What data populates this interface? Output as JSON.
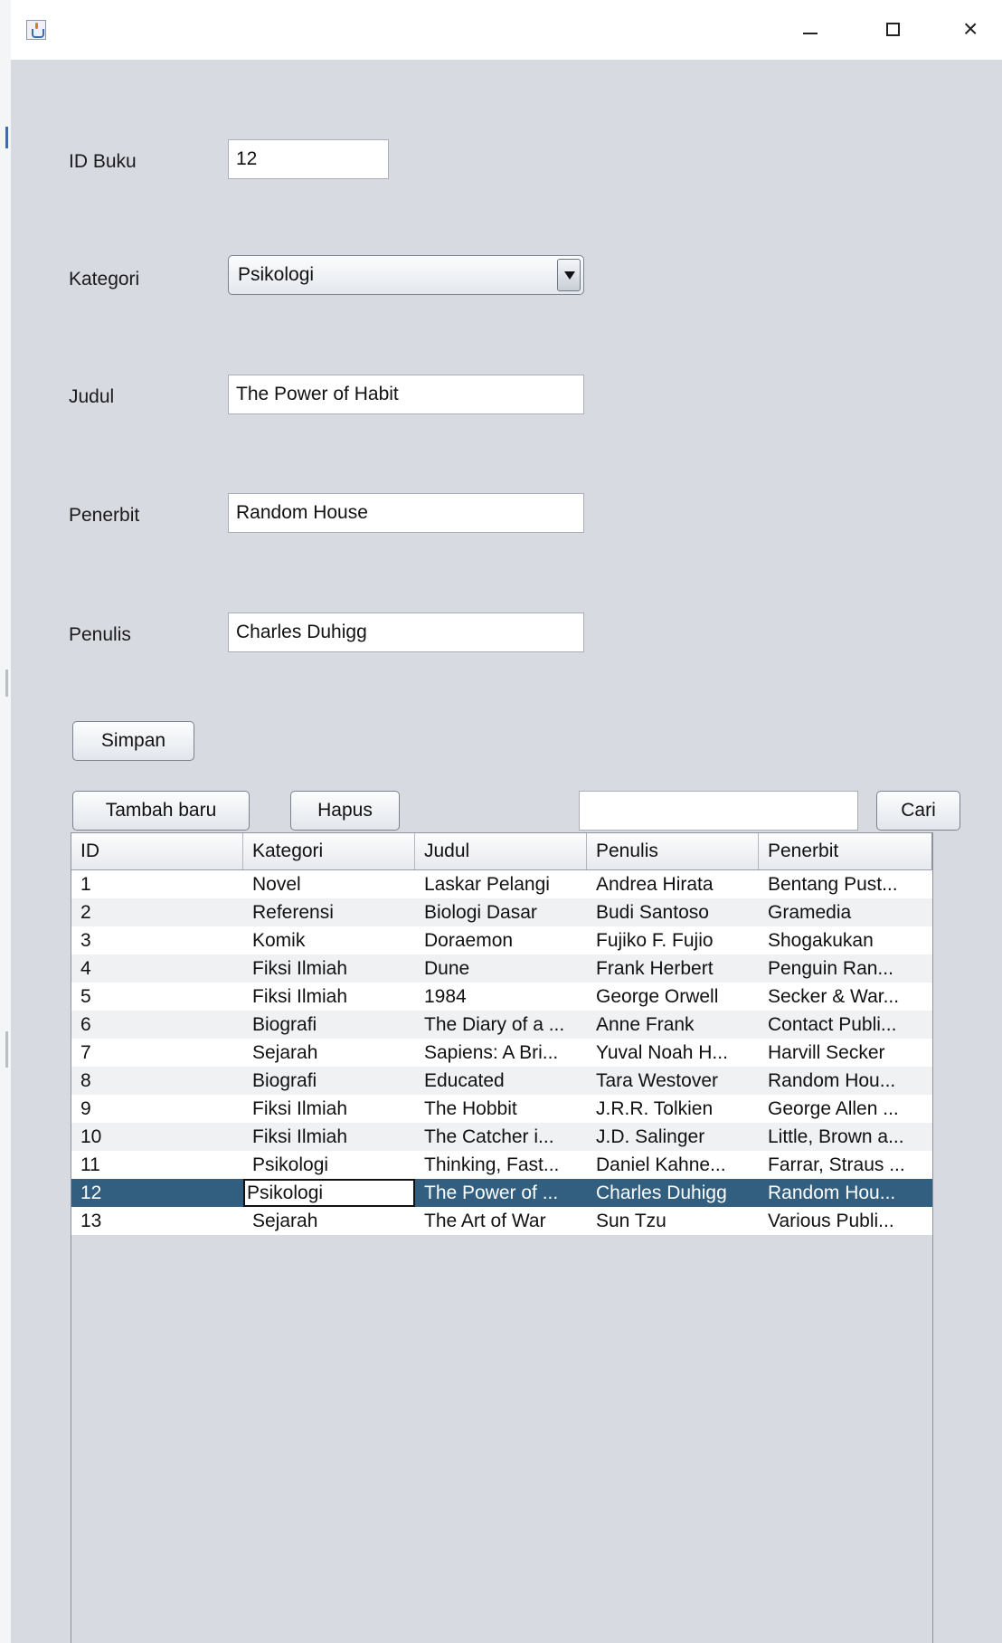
{
  "form": {
    "id_label": "ID Buku",
    "id_value": "12",
    "kategori_label": "Kategori",
    "kategori_selected": "Psikologi",
    "judul_label": "Judul",
    "judul_value": "The Power of Habit",
    "penerbit_label": "Penerbit",
    "penerbit_value": "Random House",
    "penulis_label": "Penulis",
    "penulis_value": "Charles Duhigg"
  },
  "buttons": {
    "simpan": "Simpan",
    "tambah_baru": "Tambah baru",
    "hapus": "Hapus",
    "cari": "Cari"
  },
  "search": {
    "value": ""
  },
  "table": {
    "headers": [
      "ID",
      "Kategori",
      "Judul",
      "Penulis",
      "Penerbit"
    ],
    "selected_row": 11,
    "rows": [
      [
        "1",
        "Novel",
        "Laskar Pelangi",
        "Andrea Hirata",
        "Bentang Pust..."
      ],
      [
        "2",
        "Referensi",
        "Biologi Dasar",
        "Budi Santoso",
        "Gramedia"
      ],
      [
        "3",
        "Komik",
        "Doraemon",
        "Fujiko F. Fujio",
        "Shogakukan"
      ],
      [
        "4",
        "Fiksi Ilmiah",
        "Dune",
        "Frank Herbert",
        "Penguin Ran..."
      ],
      [
        "5",
        "Fiksi Ilmiah",
        "1984",
        "George Orwell",
        "Secker & War..."
      ],
      [
        "6",
        "Biografi",
        "The Diary of a ...",
        "Anne Frank",
        "Contact Publi..."
      ],
      [
        "7",
        "Sejarah",
        "Sapiens: A Bri...",
        "Yuval Noah H...",
        "Harvill Secker"
      ],
      [
        "8",
        "Biografi",
        "Educated",
        "Tara Westover",
        "Random Hou..."
      ],
      [
        "9",
        "Fiksi Ilmiah",
        "The Hobbit",
        "J.R.R. Tolkien",
        "George Allen ..."
      ],
      [
        "10",
        "Fiksi Ilmiah",
        "The Catcher i...",
        "J.D. Salinger",
        "Little, Brown a..."
      ],
      [
        "11",
        "Psikologi",
        "Thinking, Fast...",
        "Daniel Kahne...",
        "Farrar, Straus ..."
      ],
      [
        "12",
        "Psikologi",
        "The Power of ...",
        "Charles Duhigg",
        "Random Hou..."
      ],
      [
        "13",
        "Sejarah",
        "The Art of War",
        "Sun Tzu",
        "Various Publi..."
      ]
    ]
  },
  "icons": {
    "app": "java-app-icon",
    "minimize": "minimize-icon",
    "maximize": "maximize-icon",
    "close": "close-icon",
    "dropdown": "chevron-down-icon"
  },
  "colors": {
    "window_bg": "#d7dae0",
    "selection": "#325f80",
    "row_alt": "#f0f1f3"
  }
}
